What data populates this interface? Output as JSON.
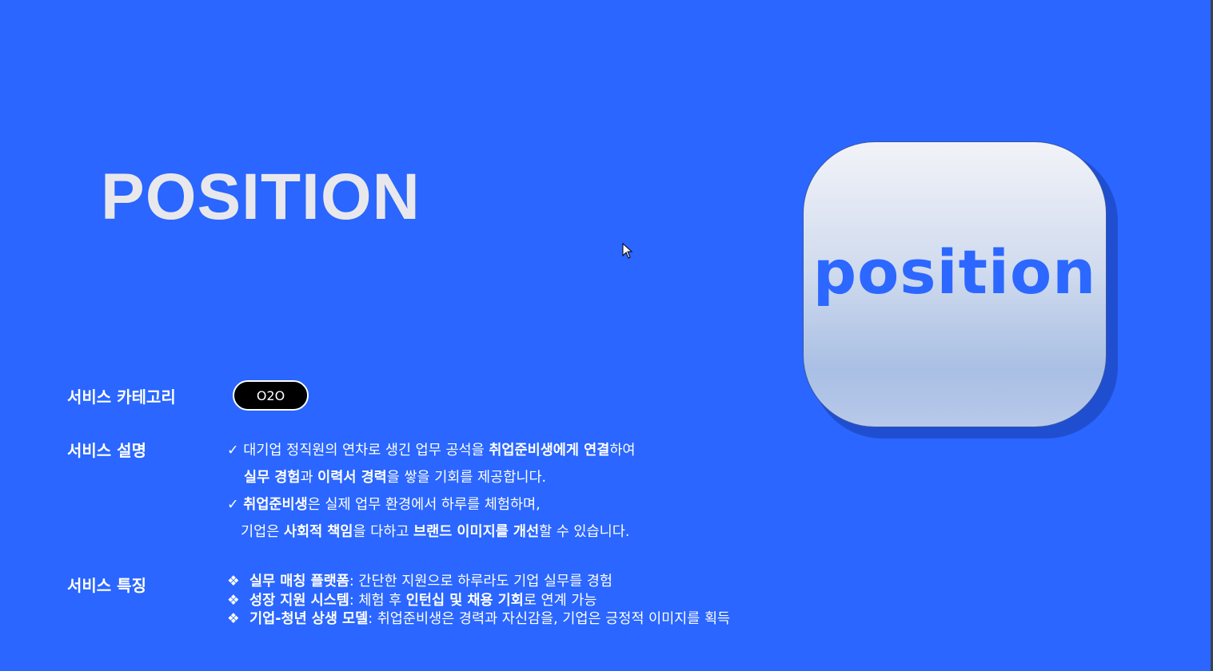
{
  "title": "POSITION",
  "logo": {
    "text": "position",
    "color": "#2c67ff"
  },
  "colors": {
    "background": "#2a66ff"
  },
  "category": {
    "label": "서비스 카테고리",
    "value": "O2O"
  },
  "description": {
    "label": "서비스 설명",
    "check_icon": "✓",
    "lines": [
      [
        {
          "t": "✓ ",
          "b": false
        },
        {
          "t": "대기업 정직원의 연차로 생긴 업무 공석을 ",
          "b": false
        },
        {
          "t": "취업준비생에게 연결",
          "b": true
        },
        {
          "t": "하여",
          "b": false
        }
      ],
      [
        {
          "t": "실무 경험",
          "b": true
        },
        {
          "t": "과 ",
          "b": false
        },
        {
          "t": "이력서 경력",
          "b": true
        },
        {
          "t": "을 쌓을 기회를 제공합니다.",
          "b": false
        }
      ],
      [
        {
          "t": "✓ ",
          "b": false
        },
        {
          "t": "취업준비생",
          "b": true
        },
        {
          "t": "은 실제 업무 환경에서 하루를 체험하며,",
          "b": false
        }
      ],
      [
        {
          "t": "기업은 ",
          "b": false
        },
        {
          "t": "사회적 책임",
          "b": true
        },
        {
          "t": "을 다하고 ",
          "b": false
        },
        {
          "t": "브랜드 이미지를 개선",
          "b": true
        },
        {
          "t": "할 수 있습니다.",
          "b": false
        }
      ]
    ]
  },
  "features": {
    "label": "서비스 특징",
    "bullet": "❖",
    "items": [
      [
        {
          "t": "실무 매칭 플랫폼",
          "b": true
        },
        {
          "t": ": 간단한 지원으로 하루라도 기업 실무를 경험",
          "b": false
        }
      ],
      [
        {
          "t": "성장 지원 시스템",
          "b": true
        },
        {
          "t": ": 체험 후 ",
          "b": false
        },
        {
          "t": "인턴십 및 채용 기회",
          "b": true
        },
        {
          "t": "로 연계 가능",
          "b": false
        }
      ],
      [
        {
          "t": "기업-청년 상생 모델",
          "b": true
        },
        {
          "t": ": 취업준비생은 경력과 자신감을, 기업은 긍정적 이미지를 획득",
          "b": false
        }
      ]
    ]
  }
}
